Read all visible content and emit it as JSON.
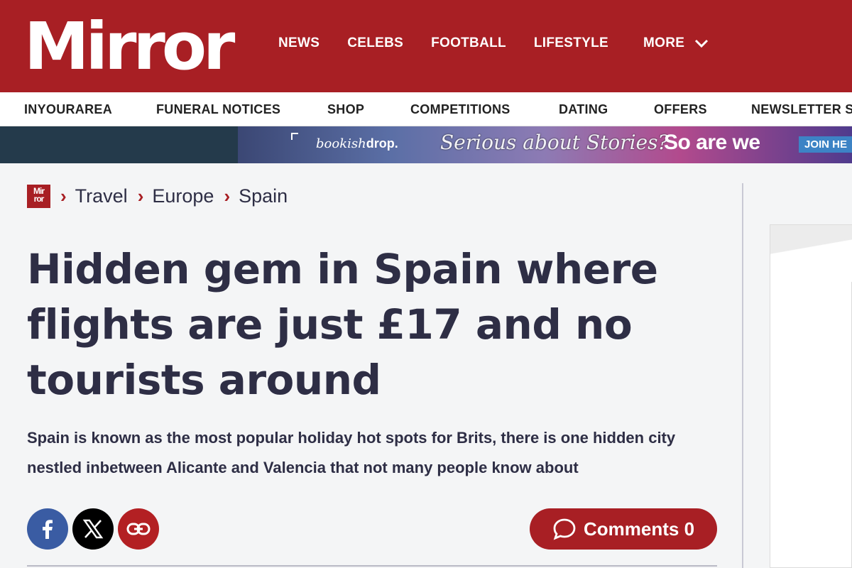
{
  "header": {
    "logo": "Mirror",
    "nav": [
      "NEWS",
      "CELEBS",
      "FOOTBALL",
      "LIFESTYLE"
    ],
    "more_label": "MORE",
    "brand_color": "#a81f24"
  },
  "subnav": {
    "items": [
      "INYOURAREA",
      "FUNERAL NOTICES",
      "SHOP",
      "COMPETITIONS",
      "DATING",
      "OFFERS",
      "NEWSLETTER S"
    ]
  },
  "promo": {
    "brand_prefix": "bookish",
    "brand_suffix": "drop.",
    "tagline": "Serious about Stories?",
    "slogan": "So are we",
    "cta": "JOIN HE"
  },
  "breadcrumb": {
    "home_logo": "Mirror",
    "items": [
      "Travel",
      "Europe",
      "Spain"
    ]
  },
  "article": {
    "headline": "Hidden gem in Spain where flights are just £17 and no tourists around",
    "standfirst": "Spain is known as the most popular holiday hot spots for Brits, there is one hidden city nestled inbetween Alicante and Valencia that not many people know about"
  },
  "share": {
    "icons": [
      "facebook-icon",
      "x-icon",
      "link-icon"
    ]
  },
  "comments": {
    "label": "Comments",
    "count": "0"
  }
}
